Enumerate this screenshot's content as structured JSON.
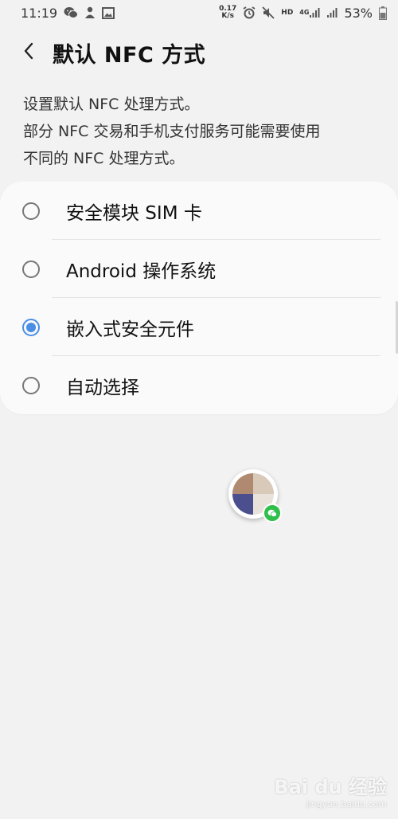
{
  "status_bar": {
    "time": "11:19",
    "net_speed_value": "0.17",
    "net_speed_unit": "K/s",
    "hd_label": "HD",
    "network_label": "4G",
    "battery_percent": "53%",
    "left_icons": [
      "wechat-icon",
      "person-icon",
      "image-icon"
    ],
    "right_icons": [
      "alarm-icon",
      "mute-icon",
      "signal-icon",
      "signal-icon",
      "battery-icon"
    ]
  },
  "header": {
    "title": "默认 NFC 方式",
    "back_icon": "chevron-left-icon"
  },
  "description": {
    "lines": [
      "设置默认 NFC 处理方式。",
      "部分 NFC 交易和手机支付服务可能需要使用",
      "不同的 NFC 处理方式。"
    ]
  },
  "options": [
    {
      "label": "安全模块 SIM 卡",
      "selected": false
    },
    {
      "label": "Android 操作系统",
      "selected": false
    },
    {
      "label": "嵌入式安全元件",
      "selected": true
    },
    {
      "label": "自动选择",
      "selected": false
    }
  ],
  "floating_bubble": {
    "badge_icon": "wechat-icon"
  },
  "watermark": {
    "text": "Bai du 经验",
    "sub": "jingyan.baidu.com"
  },
  "colors": {
    "background": "#f2f2f2",
    "card": "#fafafa",
    "accent": "#4a8ee6",
    "wechat_green": "#2fbf4a"
  }
}
